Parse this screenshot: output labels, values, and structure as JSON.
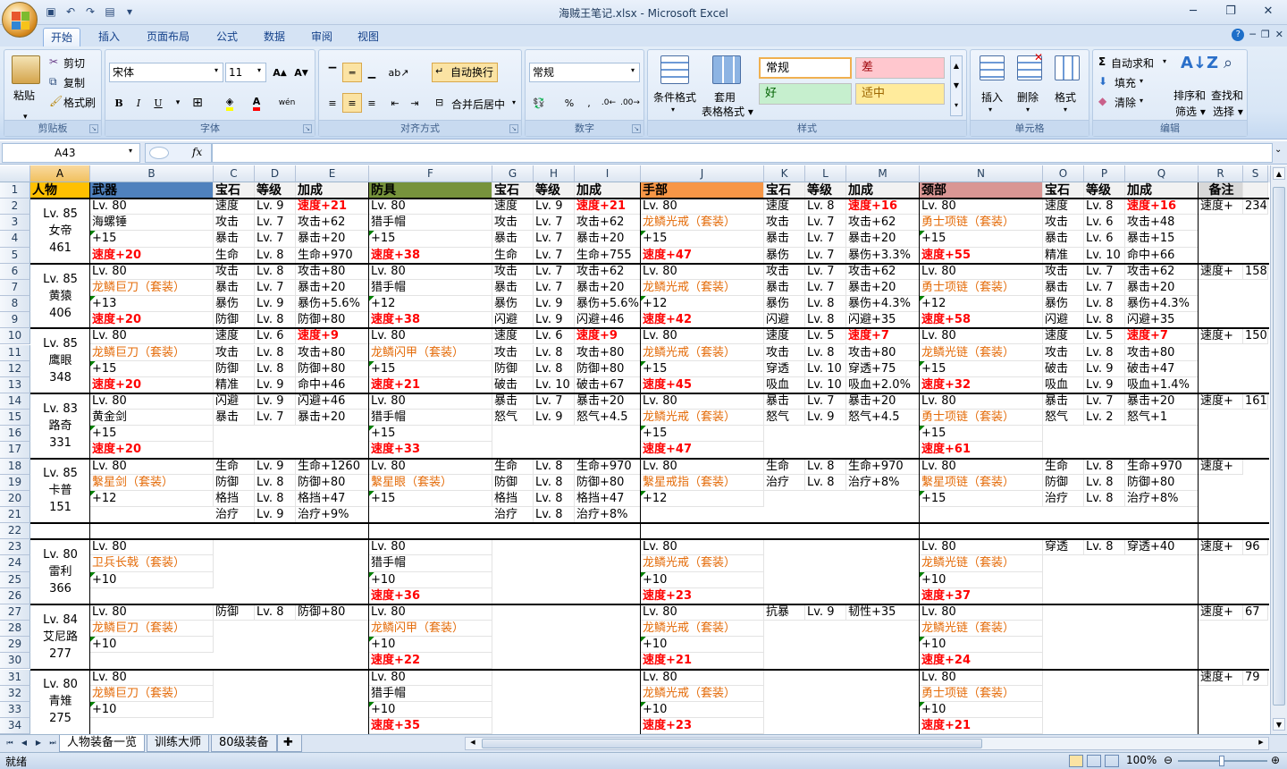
{
  "window": {
    "title": "海贼王笔记.xlsx - Microsoft Excel"
  },
  "ribbon_tabs": [
    "开始",
    "插入",
    "页面布局",
    "公式",
    "数据",
    "审阅",
    "视图"
  ],
  "ribbon": {
    "clipboard": {
      "paste": "粘贴",
      "cut": "剪切",
      "copy": "复制",
      "format_painter": "格式刷",
      "title": "剪贴板"
    },
    "font": {
      "name": "宋体",
      "size": "11",
      "title": "字体"
    },
    "alignment": {
      "wrap": "自动换行",
      "merge": "合并后居中",
      "title": "对齐方式"
    },
    "number": {
      "format": "常规",
      "title": "数字"
    },
    "styles": {
      "cond": "条件格式",
      "table": "套用\n表格格式",
      "normal": "常规",
      "bad": "差",
      "good": "好",
      "neutral": "适中",
      "title": "样式"
    },
    "cells": {
      "insert": "插入",
      "delete": "删除",
      "format": "格式",
      "title": "单元格"
    },
    "editing": {
      "autosum": "自动求和",
      "fill": "填充",
      "clear": "清除",
      "sort": "排序和\n筛选",
      "find": "查找和\n选择",
      "title": "编辑"
    }
  },
  "formula_bar": {
    "name_box": "A43",
    "fx": "fx",
    "formula": ""
  },
  "columns": [
    "A",
    "B",
    "C",
    "D",
    "E",
    "F",
    "G",
    "H",
    "I",
    "J",
    "K",
    "L",
    "M",
    "N",
    "O",
    "P",
    "Q",
    "R",
    "S"
  ],
  "selected_column": "A",
  "header_row": [
    "人物",
    "武器",
    "宝石",
    "等级",
    "加成",
    "防具",
    "宝石",
    "等级",
    "加成",
    "手部",
    "宝石",
    "等级",
    "加成",
    "颈部",
    "宝石",
    "等级",
    "加成",
    "备注",
    ""
  ],
  "characters": [
    {
      "rows": [
        2,
        5
      ],
      "level": "Lv. 85",
      "name": "女帝",
      "power": "461"
    },
    {
      "rows": [
        6,
        9
      ],
      "level": "Lv. 85",
      "name": "黄猿",
      "power": "406"
    },
    {
      "rows": [
        10,
        13
      ],
      "level": "Lv. 85",
      "name": "鹰眼",
      "power": "348"
    },
    {
      "rows": [
        14,
        17
      ],
      "level": "Lv. 83",
      "name": "路奇",
      "power": "331"
    },
    {
      "rows": [
        18,
        21
      ],
      "level": "Lv. 85",
      "name": "卡普",
      "power": "151"
    },
    {
      "rows": [
        23,
        26
      ],
      "level": "Lv. 80",
      "name": "雷利",
      "power": "366"
    },
    {
      "rows": [
        27,
        30
      ],
      "level": "Lv. 84",
      "name": "艾尼路",
      "power": "277"
    },
    {
      "rows": [
        31,
        34
      ],
      "level": "Lv. 80",
      "name": "青雉",
      "power": "275"
    }
  ],
  "rows": {
    "2": {
      "B": "Lv. 80",
      "C": "速度",
      "D": "Lv. 9",
      "E": "速度+21",
      "F": "Lv. 80",
      "G": "速度",
      "H": "Lv. 9",
      "I": "速度+21",
      "J": "Lv. 80",
      "K": "速度",
      "L": "Lv. 8",
      "M": "速度+16",
      "N": "Lv. 80",
      "O": "速度",
      "P": "Lv. 8",
      "Q": "速度+16",
      "R": "速度+",
      "S": "234"
    },
    "3": {
      "B": "海螺锤",
      "C": "攻击",
      "D": "Lv. 7",
      "E": "攻击+62",
      "F": "猎手帽",
      "G": "攻击",
      "H": "Lv. 7",
      "I": "攻击+62",
      "J": "龙鳞光戒（套装）",
      "K": "攻击",
      "L": "Lv. 7",
      "M": "攻击+62",
      "N": "勇士项链（套装）",
      "O": "攻击",
      "P": "Lv. 6",
      "Q": "攻击+48"
    },
    "4": {
      "B": "+15",
      "C": "暴击",
      "D": "Lv. 7",
      "E": "暴击+20",
      "F": "+15",
      "G": "暴击",
      "H": "Lv. 7",
      "I": "暴击+20",
      "J": "+15",
      "K": "暴击",
      "L": "Lv. 7",
      "M": "暴击+20",
      "N": "+15",
      "O": "暴击",
      "P": "Lv. 6",
      "Q": "暴击+15"
    },
    "5": {
      "B": "速度+20",
      "C": "生命",
      "D": "Lv. 8",
      "E": "生命+970",
      "F": "速度+38",
      "G": "生命",
      "H": "Lv. 7",
      "I": "生命+755",
      "J": "速度+47",
      "K": "暴伤",
      "L": "Lv. 7",
      "M": "暴伤+3.3%",
      "N": "速度+55",
      "O": "精准",
      "P": "Lv. 10",
      "Q": "命中+66"
    },
    "6": {
      "B": "Lv. 80",
      "C": "攻击",
      "D": "Lv. 8",
      "E": "攻击+80",
      "F": "Lv. 80",
      "G": "攻击",
      "H": "Lv. 7",
      "I": "攻击+62",
      "J": "Lv. 80",
      "K": "攻击",
      "L": "Lv. 7",
      "M": "攻击+62",
      "N": "Lv. 80",
      "O": "攻击",
      "P": "Lv. 7",
      "Q": "攻击+62",
      "R": "速度+",
      "S": "158"
    },
    "7": {
      "B": "龙鳞巨刀（套装）",
      "C": "暴击",
      "D": "Lv. 7",
      "E": "暴击+20",
      "F": "猎手帽",
      "G": "暴击",
      "H": "Lv. 7",
      "I": "暴击+20",
      "J": "龙鳞光戒（套装）",
      "K": "暴击",
      "L": "Lv. 7",
      "M": "暴击+20",
      "N": "勇士项链（套装）",
      "O": "暴击",
      "P": "Lv. 7",
      "Q": "暴击+20"
    },
    "8": {
      "B": "+13",
      "C": "暴伤",
      "D": "Lv. 9",
      "E": "暴伤+5.6%",
      "F": "+12",
      "G": "暴伤",
      "H": "Lv. 9",
      "I": "暴伤+5.6%",
      "J": "+12",
      "K": "暴伤",
      "L": "Lv. 8",
      "M": "暴伤+4.3%",
      "N": "+12",
      "O": "暴伤",
      "P": "Lv. 8",
      "Q": "暴伤+4.3%"
    },
    "9": {
      "B": "速度+20",
      "C": "防御",
      "D": "Lv. 8",
      "E": "防御+80",
      "F": "速度+38",
      "G": "闪避",
      "H": "Lv. 9",
      "I": "闪避+46",
      "J": "速度+42",
      "K": "闪避",
      "L": "Lv. 8",
      "M": "闪避+35",
      "N": "速度+58",
      "O": "闪避",
      "P": "Lv. 8",
      "Q": "闪避+35"
    },
    "10": {
      "B": "Lv. 80",
      "C": "速度",
      "D": "Lv. 6",
      "E": "速度+9",
      "F": "Lv. 80",
      "G": "速度",
      "H": "Lv. 6",
      "I": "速度+9",
      "J": "Lv. 80",
      "K": "速度",
      "L": "Lv. 5",
      "M": "速度+7",
      "N": "Lv. 80",
      "O": "速度",
      "P": "Lv. 5",
      "Q": "速度+7",
      "R": "速度+",
      "S": "150"
    },
    "11": {
      "B": "龙鳞巨刀（套装）",
      "C": "攻击",
      "D": "Lv. 8",
      "E": "攻击+80",
      "F": "龙鳞闪甲（套装）",
      "G": "攻击",
      "H": "Lv. 8",
      "I": "攻击+80",
      "J": "龙鳞光戒（套装）",
      "K": "攻击",
      "L": "Lv. 8",
      "M": "攻击+80",
      "N": "龙鳞光链（套装）",
      "O": "攻击",
      "P": "Lv. 8",
      "Q": "攻击+80"
    },
    "12": {
      "B": "+15",
      "C": "防御",
      "D": "Lv. 8",
      "E": "防御+80",
      "F": "+15",
      "G": "防御",
      "H": "Lv. 8",
      "I": "防御+80",
      "J": "+15",
      "K": "穿透",
      "L": "Lv. 10",
      "M": "穿透+75",
      "N": "+15",
      "O": "破击",
      "P": "Lv. 9",
      "Q": "破击+47"
    },
    "13": {
      "B": "速度+20",
      "C": "精准",
      "D": "Lv. 9",
      "E": "命中+46",
      "F": "速度+21",
      "G": "破击",
      "H": "Lv. 10",
      "I": "破击+67",
      "J": "速度+45",
      "K": "吸血",
      "L": "Lv. 10",
      "M": "吸血+2.0%",
      "N": "速度+32",
      "O": "吸血",
      "P": "Lv. 9",
      "Q": "吸血+1.4%"
    },
    "14": {
      "B": "Lv. 80",
      "C": "闪避",
      "D": "Lv. 9",
      "E": "闪避+46",
      "F": "Lv. 80",
      "G": "暴击",
      "H": "Lv. 7",
      "I": "暴击+20",
      "J": "Lv. 80",
      "K": "暴击",
      "L": "Lv. 7",
      "M": "暴击+20",
      "N": "Lv. 80",
      "O": "暴击",
      "P": "Lv. 7",
      "Q": "暴击+20",
      "R": "速度+",
      "S": "161"
    },
    "15": {
      "B": "黄金剑",
      "C": "暴击",
      "D": "Lv. 7",
      "E": "暴击+20",
      "F": "猎手帽",
      "G": "怒气",
      "H": "Lv. 9",
      "I": "怒气+4.5",
      "J": "龙鳞光戒（套装）",
      "K": "怒气",
      "L": "Lv. 9",
      "M": "怒气+4.5",
      "N": "勇士项链（套装）",
      "O": "怒气",
      "P": "Lv. 2",
      "Q": "怒气+1"
    },
    "16": {
      "B": "+15",
      "F": "+15",
      "J": "+15",
      "N": "+15"
    },
    "17": {
      "B": "速度+20",
      "F": "速度+33",
      "J": "速度+47",
      "N": "速度+61"
    },
    "18": {
      "B": "Lv. 80",
      "C": "生命",
      "D": "Lv. 9",
      "E": "生命+1260",
      "F": "Lv. 80",
      "G": "生命",
      "H": "Lv. 8",
      "I": "生命+970",
      "J": "Lv. 80",
      "K": "生命",
      "L": "Lv. 8",
      "M": "生命+970",
      "N": "Lv. 80",
      "O": "生命",
      "P": "Lv. 8",
      "Q": "生命+970",
      "R": "速度+"
    },
    "19": {
      "B": "繫星剑（套装）",
      "C": "防御",
      "D": "Lv. 8",
      "E": "防御+80",
      "F": "繫星眼（套装）",
      "G": "防御",
      "H": "Lv. 8",
      "I": "防御+80",
      "J": "繫星戒指（套装）",
      "K": "治疗",
      "L": "Lv. 8",
      "M": "治疗+8%",
      "N": "繫星项链（套装）",
      "O": "防御",
      "P": "Lv. 8",
      "Q": "防御+80"
    },
    "20": {
      "B": "+12",
      "C": "格挡",
      "D": "Lv. 8",
      "E": "格挡+47",
      "F": "+15",
      "G": "格挡",
      "H": "Lv. 8",
      "I": "格挡+47",
      "J": "+12",
      "N": "+15",
      "O": "治疗",
      "P": "Lv. 8",
      "Q": "治疗+8%"
    },
    "21": {
      "C": "治疗",
      "D": "Lv. 9",
      "E": "治疗+9%",
      "G": "治疗",
      "H": "Lv. 8",
      "I": "治疗+8%"
    },
    "22": {},
    "23": {
      "B": "Lv. 80",
      "F": "Lv. 80",
      "J": "Lv. 80",
      "N": "Lv. 80",
      "O": "穿透",
      "P": "Lv. 8",
      "Q": "穿透+40",
      "R": "速度+",
      "S": "96"
    },
    "24": {
      "B": "卫兵长戟（套装）",
      "F": "猎手帽",
      "J": "龙鳞光戒（套装）",
      "N": "龙鳞光链（套装）"
    },
    "25": {
      "B": "+10",
      "F": "+10",
      "J": "+10",
      "N": "+10"
    },
    "26": {
      "F": "速度+36",
      "J": "速度+23",
      "N": "速度+37"
    },
    "27": {
      "B": "Lv. 80",
      "C": "防御",
      "D": "Lv. 8",
      "E": "防御+80",
      "F": "Lv. 80",
      "J": "Lv. 80",
      "K": "抗暴",
      "L": "Lv. 9",
      "M": "韧性+35",
      "N": "Lv. 80",
      "R": "速度+",
      "S": "67"
    },
    "28": {
      "B": "龙鳞巨刀（套装）",
      "F": "龙鳞闪甲（套装）",
      "J": "龙鳞光戒（套装）",
      "N": "龙鳞光链（套装）"
    },
    "29": {
      "B": "+10",
      "F": "+10",
      "J": "+10",
      "N": "+10"
    },
    "30": {
      "F": "速度+22",
      "J": "速度+21",
      "N": "速度+24"
    },
    "31": {
      "B": "Lv. 80",
      "F": "Lv. 80",
      "J": "Lv. 80",
      "N": "Lv. 80",
      "R": "速度+",
      "S": "79"
    },
    "32": {
      "B": "龙鳞巨刀（套装）",
      "F": "猎手帽",
      "J": "龙鳞光戒（套装）",
      "N": "勇士项链（套装）"
    },
    "33": {
      "B": "+10",
      "F": "+10",
      "J": "+10",
      "N": "+10"
    },
    "34": {
      "F": "速度+35",
      "J": "速度+23",
      "N": "速度+21"
    }
  },
  "sheet_tabs": [
    "人物装备一览",
    "训练大师",
    "80级装备"
  ],
  "active_sheet": "人物装备一览",
  "status": {
    "ready": "就绪",
    "zoom": "100%"
  },
  "colors": {
    "weapon_header": "#4f81bd",
    "armor_header": "#77933c",
    "hand_header": "#f79646",
    "neck_header": "#d99694",
    "note_header": "#d8d8d8",
    "speed_red": "#ff0000",
    "set_orange": "#e46c0a"
  }
}
